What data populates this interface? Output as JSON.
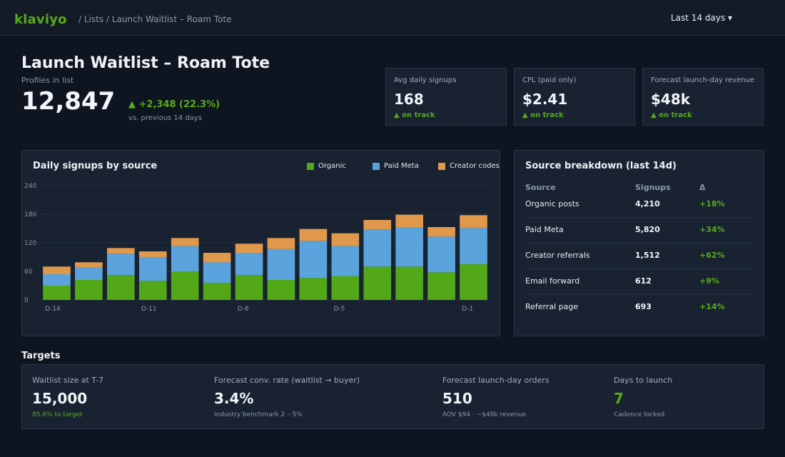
{
  "app": {
    "logo": "klaviyo",
    "breadcrumb": "/ Lists / Launch Waitlist – Roam Tote",
    "date_range": "Last 14 days ▾"
  },
  "header": {
    "title": "Launch Waitlist – Roam Tote",
    "profiles_label": "Profiles in list",
    "profiles_value": "12,847",
    "delta": "▲ +2,348 (22.3%)",
    "delta_note": "vs. previous 14 days"
  },
  "kpis": [
    {
      "label": "Avg daily signups",
      "value": "168",
      "status": "▲ on track"
    },
    {
      "label": "CPL (paid only)",
      "value": "$2.41",
      "status": "▲ on track"
    },
    {
      "label": "Forecast launch-day revenue",
      "value": "$48k",
      "status": "▲ on track"
    }
  ],
  "chart_panel": {
    "title": "Daily signups by source"
  },
  "chart_data": {
    "type": "bar",
    "stacked": true,
    "categories": [
      "D-14",
      "D-13",
      "D-12",
      "D-11",
      "D-10",
      "D-9",
      "D-8",
      "D-7",
      "D-6",
      "D-5",
      "D-4",
      "D-3",
      "D-2",
      "D-1"
    ],
    "x_tick_labels": [
      "D-14",
      "",
      "",
      "D-11",
      "",
      "",
      "D-8",
      "",
      "",
      "D-5",
      "",
      "",
      "",
      "D-1"
    ],
    "series": [
      {
        "name": "Organic",
        "color": "#52a817",
        "values": [
          30,
          42,
          52,
          40,
          60,
          36,
          52,
          42,
          46,
          50,
          70,
          70,
          58,
          75
        ]
      },
      {
        "name": "Paid Meta",
        "color": "#5ba3dc",
        "values": [
          24,
          26,
          45,
          50,
          53,
          43,
          47,
          65,
          78,
          63,
          78,
          83,
          75,
          76
        ]
      },
      {
        "name": "Creator codes",
        "color": "#e0994a",
        "values": [
          16,
          11,
          12,
          12,
          17,
          20,
          19,
          23,
          25,
          27,
          20,
          26,
          20,
          27
        ]
      }
    ],
    "ylim": [
      0,
      240
    ],
    "yticks": [
      0,
      60,
      120,
      180,
      240
    ],
    "grid": true,
    "legend": "top-right"
  },
  "breakdown": {
    "title": "Source breakdown (last 14d)",
    "headers": {
      "source": "Source",
      "signups": "Signups",
      "delta": "Δ"
    },
    "rows": [
      {
        "source": "Organic posts",
        "signups": "4,210",
        "delta": "+18%"
      },
      {
        "source": "Paid Meta",
        "signups": "5,820",
        "delta": "+34%"
      },
      {
        "source": "Creator referrals",
        "signups": "1,512",
        "delta": "+62%"
      },
      {
        "source": "Email forward",
        "signups": "612",
        "delta": "+9%"
      },
      {
        "source": "Referral page",
        "signups": "693",
        "delta": "+14%"
      }
    ]
  },
  "targets": {
    "title": "Targets",
    "items": [
      {
        "label": "Waitlist size at T-7",
        "value": "15,000",
        "sub": "85.6% to target"
      },
      {
        "label": "Forecast conv. rate (waitlist → buyer)",
        "value": "3.4%",
        "sub": "Industry benchmark 2 – 5%"
      },
      {
        "label": "Forecast launch-day orders",
        "value": "510",
        "sub": "AOV $94 · ~$48k revenue"
      },
      {
        "label": "Days to launch",
        "value": "7",
        "sub": "Cadence locked"
      }
    ]
  }
}
